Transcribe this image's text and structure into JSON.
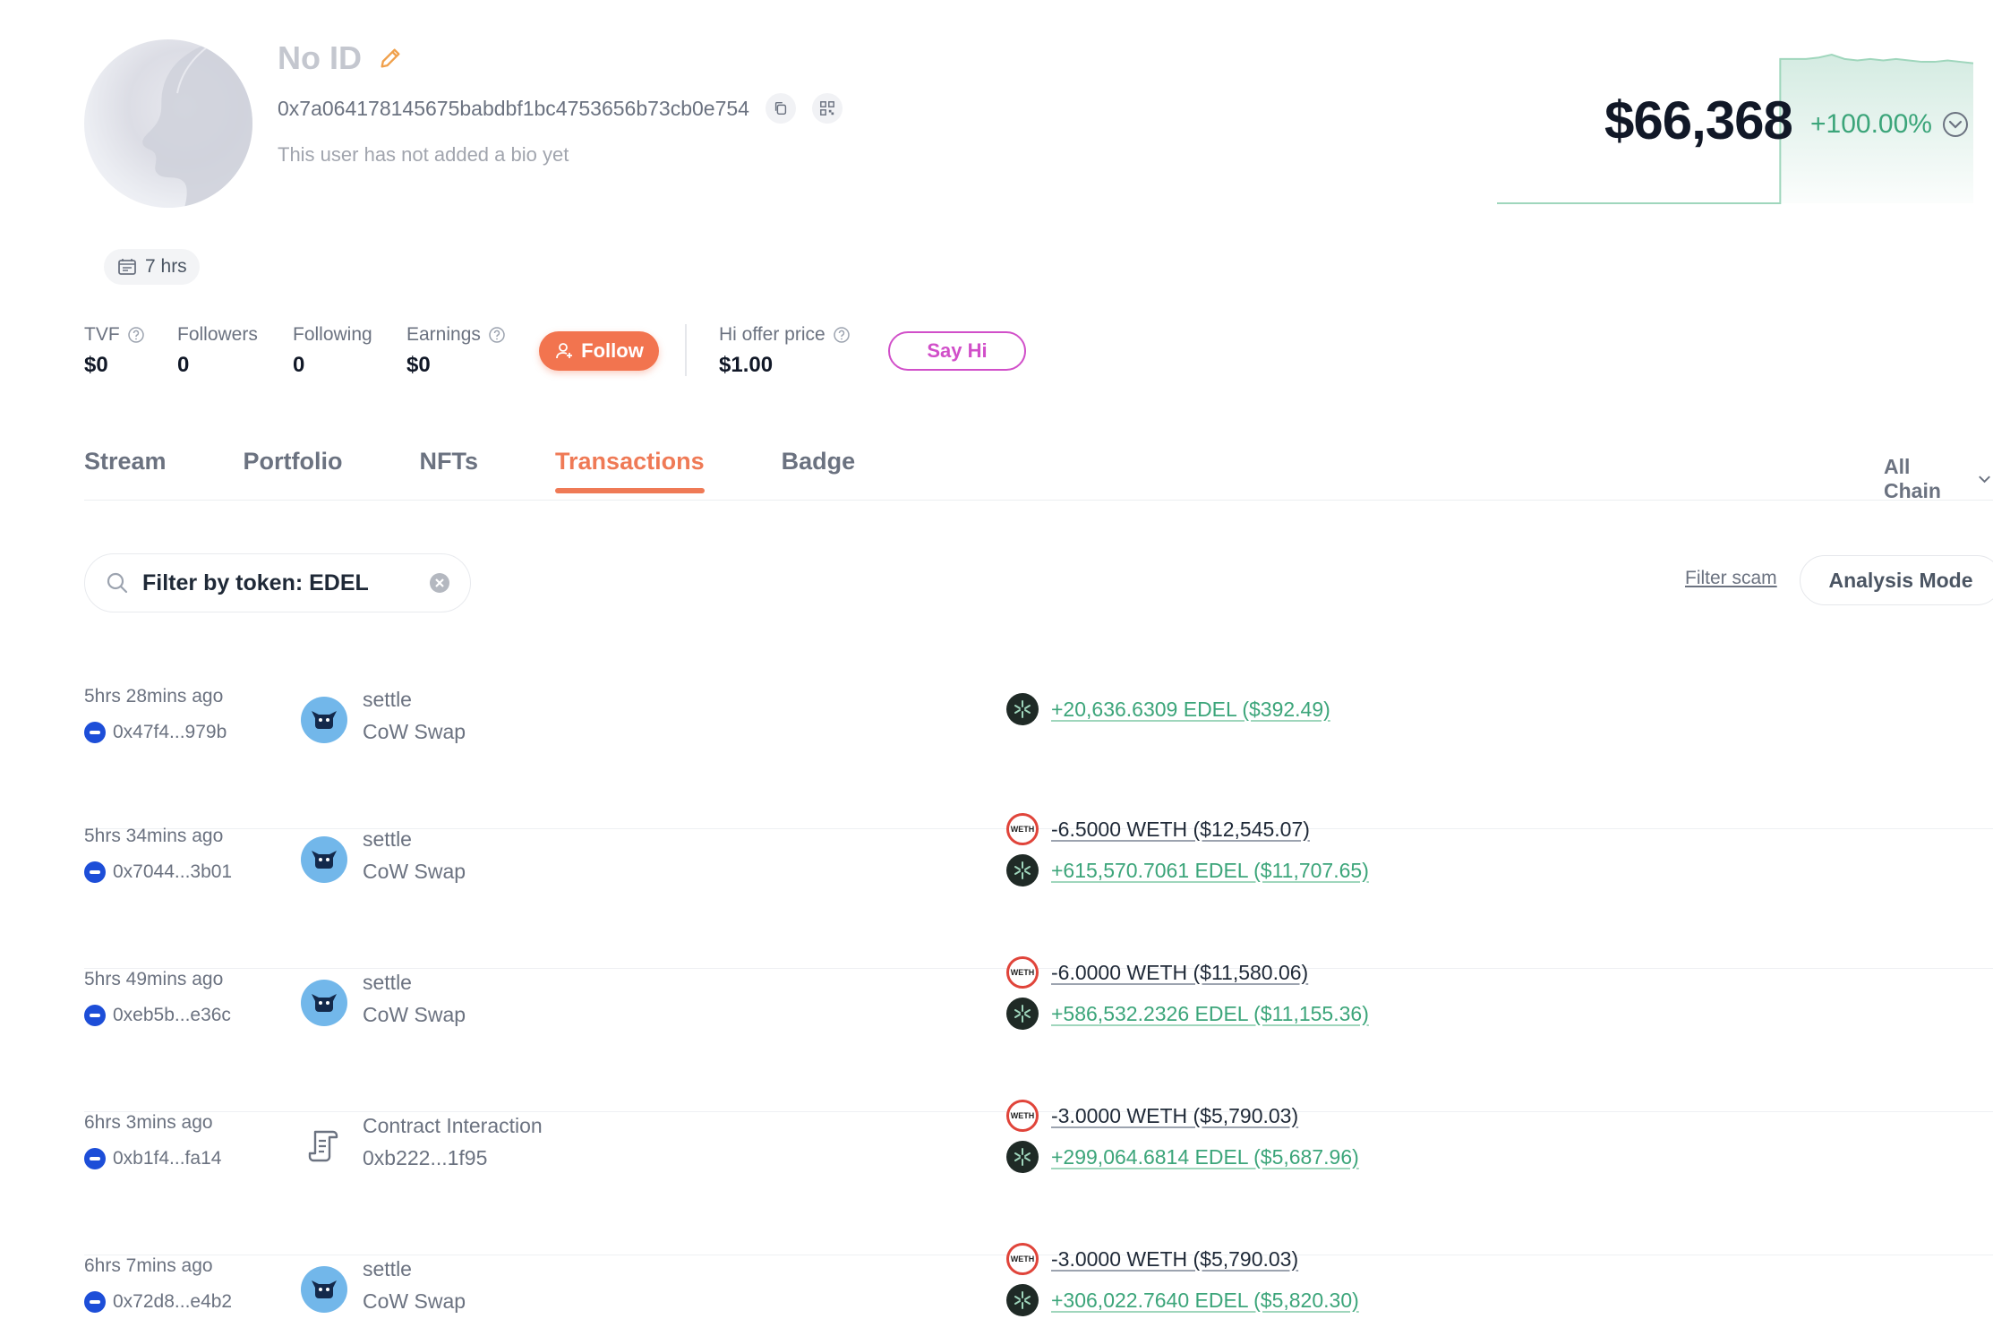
{
  "profile": {
    "name": "No ID",
    "address": "0x7a064178145675babdbf1bc4753656b73cb0e754",
    "bio": "This user has not added a bio yet",
    "active_time": "7 hrs"
  },
  "balance": {
    "total": "$66,368",
    "change": "+100.00%",
    "chart_points": [
      0,
      0,
      0,
      0,
      0,
      0,
      0,
      0,
      0,
      0,
      0,
      0,
      0,
      0,
      0,
      0,
      0,
      0,
      0,
      0,
      0,
      0,
      100,
      100,
      100,
      101,
      103,
      100,
      99,
      100,
      99,
      100,
      99,
      98,
      98,
      99,
      98,
      97
    ],
    "colors": {
      "positive": "#3ca57a"
    }
  },
  "stats": {
    "tvf_label": "TVF",
    "tvf_value": "$0",
    "followers_label": "Followers",
    "followers_value": "0",
    "following_label": "Following",
    "following_value": "0",
    "earnings_label": "Earnings",
    "earnings_value": "$0",
    "follow_label": "Follow",
    "hi_offer_label": "Hi offer price",
    "hi_offer_value": "$1.00",
    "say_hi_label": "Say Hi"
  },
  "tabs": [
    {
      "label": "Stream"
    },
    {
      "label": "Portfolio"
    },
    {
      "label": "NFTs"
    },
    {
      "label": "Transactions"
    },
    {
      "label": "Badge"
    }
  ],
  "chain_filter": "All Chain",
  "filter": {
    "value": "Filter by token: EDEL",
    "placeholder": "Filter by token: EDEL",
    "filter_scam": "Filter scam",
    "analysis_mode": "Analysis Mode"
  },
  "transactions": [
    {
      "time": "5hrs 28mins ago",
      "hash": "0x47f4...979b",
      "action": "settle",
      "protocol": "CoW Swap",
      "icon": "cow-icon",
      "changes": [
        {
          "token": "edel-icon",
          "amount": "+20,636.6309 EDEL ($392.49)",
          "positive": true
        }
      ]
    },
    {
      "time": "5hrs 34mins ago",
      "hash": "0x7044...3b01",
      "action": "settle",
      "protocol": "CoW Swap",
      "icon": "cow-icon",
      "changes": [
        {
          "token": "weth-icon",
          "amount": "-6.5000 WETH ($12,545.07)",
          "positive": false
        },
        {
          "token": "edel-icon",
          "amount": "+615,570.7061 EDEL ($11,707.65)",
          "positive": true
        }
      ]
    },
    {
      "time": "5hrs 49mins ago",
      "hash": "0xeb5b...e36c",
      "action": "settle",
      "protocol": "CoW Swap",
      "icon": "cow-icon",
      "changes": [
        {
          "token": "weth-icon",
          "amount": "-6.0000 WETH ($11,580.06)",
          "positive": false
        },
        {
          "token": "edel-icon",
          "amount": "+586,532.2326 EDEL ($11,155.36)",
          "positive": true
        }
      ]
    },
    {
      "time": "6hrs 3mins ago",
      "hash": "0xb1f4...fa14",
      "action": "Contract Interaction",
      "protocol": "0xb222...1f95",
      "icon": "contract-icon",
      "changes": [
        {
          "token": "weth-icon",
          "amount": "-3.0000 WETH ($5,790.03)",
          "positive": false
        },
        {
          "token": "edel-icon",
          "amount": "+299,064.6814 EDEL ($5,687.96)",
          "positive": true
        }
      ]
    },
    {
      "time": "6hrs 7mins ago",
      "hash": "0x72d8...e4b2",
      "action": "settle",
      "protocol": "CoW Swap",
      "icon": "cow-icon",
      "changes": [
        {
          "token": "weth-icon",
          "amount": "-3.0000 WETH ($5,790.03)",
          "positive": false
        },
        {
          "token": "edel-icon",
          "amount": "+306,022.7640 EDEL ($5,820.30)",
          "positive": true
        }
      ]
    }
  ],
  "token_icon_text": {
    "weth": "WETH"
  },
  "colors": {
    "accent": "#ef7a56",
    "follow_button": "#f2744f",
    "say_hi": "#d14fc9",
    "positive": "#3ca57a",
    "chain": "#1d4ed8"
  }
}
